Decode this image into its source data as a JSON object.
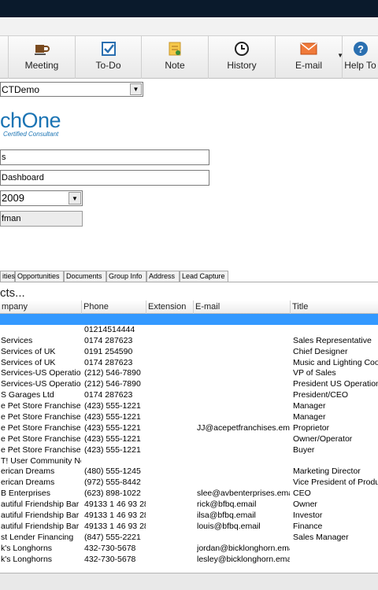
{
  "toolbar": {
    "buttons": [
      {
        "label": "Meeting",
        "icon": "meeting-cup-icon"
      },
      {
        "label": "To-Do",
        "icon": "todo-check-icon"
      },
      {
        "label": "Note",
        "icon": "note-icon"
      },
      {
        "label": "History",
        "icon": "history-clock-icon"
      },
      {
        "label": "E-mail",
        "icon": "email-envelope-icon"
      },
      {
        "label": "Help To",
        "icon": "help-icon"
      }
    ]
  },
  "database": {
    "value": "CTDemo"
  },
  "logo": {
    "main": "chOne",
    "sub": "Certified Consultant"
  },
  "fields": {
    "field1": "s",
    "field2": "Dashboard",
    "year": "2009",
    "manager": "fman"
  },
  "tabs": [
    "ities",
    "Opportunities",
    "Documents",
    "Group Info",
    "Address",
    "Lead Capture"
  ],
  "section": {
    "title": "cts..."
  },
  "grid": {
    "columns": [
      "mpany",
      "Phone",
      "Extension",
      "E-mail",
      "Title"
    ],
    "rows": [
      {
        "company": "",
        "phone": "",
        "ext": "",
        "email": "",
        "title": "",
        "selected": true
      },
      {
        "company": "",
        "phone": "01214514444",
        "ext": "",
        "email": "",
        "title": ""
      },
      {
        "company": "Services",
        "phone": "0174 287623",
        "ext": "",
        "email": "",
        "title": "Sales Representative"
      },
      {
        "company": "Services of UK",
        "phone": "0191 254590",
        "ext": "",
        "email": "",
        "title": "Chief Designer"
      },
      {
        "company": "Services of UK",
        "phone": "0174 287623",
        "ext": "",
        "email": "",
        "title": "Music and Lighting Coo"
      },
      {
        "company": "Services-US Operatio",
        "phone": "(212) 546-7890",
        "ext": "",
        "email": "",
        "title": "VP of Sales"
      },
      {
        "company": "Services-US Operatio",
        "phone": "(212) 546-7890",
        "ext": "",
        "email": "",
        "title": "President US Operation"
      },
      {
        "company": "S Garages Ltd",
        "phone": "0174 287623",
        "ext": "",
        "email": "",
        "title": "President/CEO"
      },
      {
        "company": "e Pet Store Franchises",
        "phone": "(423) 555-1221",
        "ext": "",
        "email": "",
        "title": "Manager"
      },
      {
        "company": "e Pet Store Franchises",
        "phone": "(423) 555-1221",
        "ext": "",
        "email": "",
        "title": "Manager"
      },
      {
        "company": "e Pet Store Franchises",
        "phone": "(423) 555-1221",
        "ext": "",
        "email": "JJ@acepetfranchises.em",
        "title": "Proprietor"
      },
      {
        "company": "e Pet Store Franchises",
        "phone": "(423) 555-1221",
        "ext": "",
        "email": "",
        "title": "Owner/Operator"
      },
      {
        "company": "e Pet Store Franchises",
        "phone": "(423) 555-1221",
        "ext": "",
        "email": "",
        "title": "Buyer"
      },
      {
        "company": "T! User Community Ne",
        "phone": "",
        "ext": "",
        "email": "",
        "title": ""
      },
      {
        "company": "erican Dreams",
        "phone": "(480) 555-1245",
        "ext": "",
        "email": "",
        "title": "Marketing Director"
      },
      {
        "company": "erican Dreams",
        "phone": "(972) 555-8442",
        "ext": "",
        "email": "",
        "title": "Vice President of Produ"
      },
      {
        "company": "B Enterprises",
        "phone": "(623) 898-1022",
        "ext": "",
        "email": "slee@avbenterprises.ema",
        "title": "CEO"
      },
      {
        "company": "autiful Friendship Bar 8",
        "phone": "49133 1 46 93 28",
        "ext": "",
        "email": "rick@bfbq.email",
        "title": "Owner"
      },
      {
        "company": "autiful Friendship Bar 8",
        "phone": "49133 1 46 93 28",
        "ext": "",
        "email": "ilsa@bfbq.email",
        "title": "Investor"
      },
      {
        "company": "autiful Friendship Bar 8",
        "phone": "49133 1 46 93 28",
        "ext": "",
        "email": "louis@bfbq.email",
        "title": "Finance"
      },
      {
        "company": "st Lender Financing",
        "phone": "(847) 555-2221",
        "ext": "",
        "email": "",
        "title": "Sales Manager"
      },
      {
        "company": "k's Longhorns",
        "phone": "432-730-5678",
        "ext": "",
        "email": "jordan@bicklonghorn.ema",
        "title": ""
      },
      {
        "company": "k's Longhorns",
        "phone": "432-730-5678",
        "ext": "",
        "email": "lesley@bicklonghorn.ema",
        "title": ""
      }
    ]
  }
}
